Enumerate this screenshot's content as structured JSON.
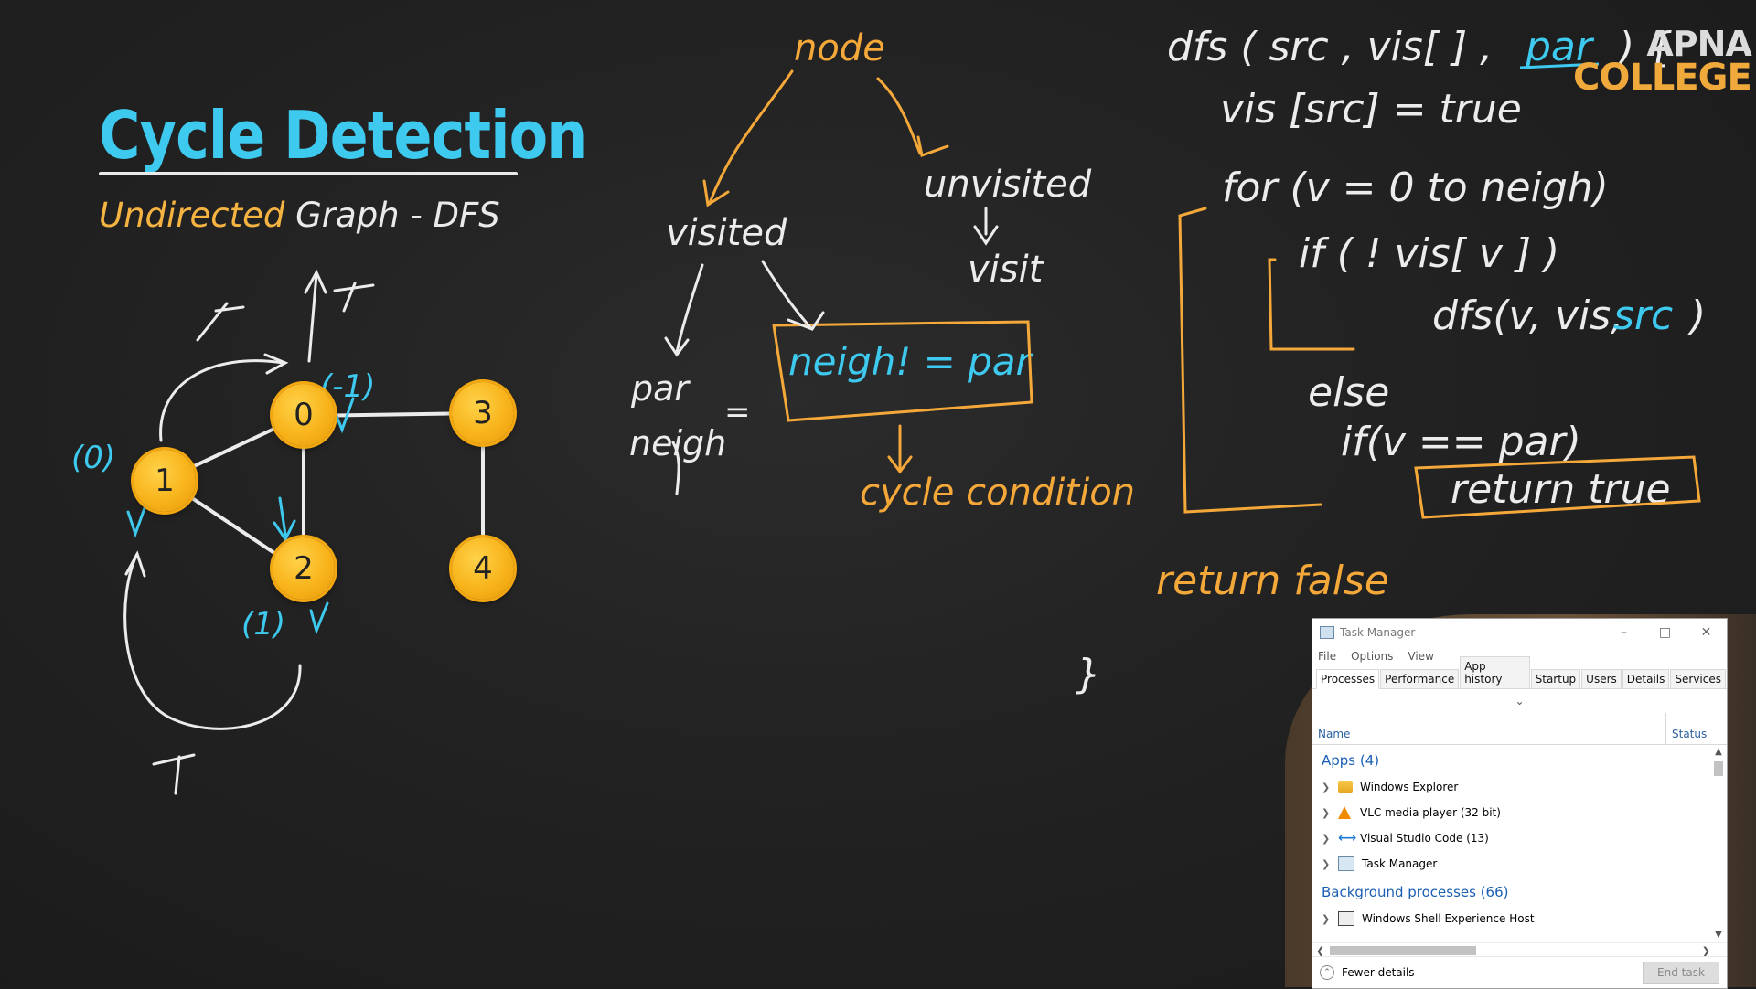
{
  "slide": {
    "title": "Cycle Detection",
    "subtitle_highlight": "Undirected",
    "subtitle_rest": " Graph - DFS"
  },
  "graph": {
    "nodes": [
      "0",
      "1",
      "2",
      "3",
      "4"
    ],
    "annotations": {
      "node0_parent": "(-1)",
      "node1_parent": "(0)",
      "node2_parent": "(1)",
      "visited_mark": "v",
      "tree_mark": "T"
    }
  },
  "notes": {
    "node": "node",
    "visited": "visited",
    "unvisited": "unvisited",
    "visit": "visit",
    "par_neigh": "par",
    "neigh_label": "neigh",
    "equals": "=",
    "condition": "neigh! = par",
    "cycle_condition": "cycle condition"
  },
  "code": {
    "line1": "dfs ( src , vis[ ] ,",
    "line1_par": "par",
    "line1_end": ") {",
    "line2": "vis [src] = true",
    "line3": "for (v = 0 to neigh)",
    "line4": "if ( ! vis[ v ] )",
    "line5": "dfs(v, vis,",
    "line5_src": "src",
    "line5_end": ")",
    "line6": "else",
    "line7": "if(v == par)",
    "line8": "return true",
    "line9": "return false",
    "line10": "}"
  },
  "logo": {
    "line1": "APNA",
    "line2": "COLLEGE"
  },
  "taskmanager": {
    "title": "Task Manager",
    "menu": [
      "File",
      "Options",
      "View"
    ],
    "tabs": [
      "Processes",
      "Performance",
      "App history",
      "Startup",
      "Users",
      "Details",
      "Services"
    ],
    "active_tab": "Processes",
    "columns": {
      "name": "Name",
      "status": "Status"
    },
    "apps_group": "Apps (4)",
    "apps": [
      "Windows Explorer",
      "VLC media player (32 bit)",
      "Visual Studio Code (13)",
      "Task Manager"
    ],
    "background_group": "Background processes (66)",
    "background": [
      "Windows Shell Experience Host"
    ],
    "fewer_details": "Fewer details",
    "end_task": "End task"
  },
  "colors": {
    "cyan": "#3ec9ef",
    "orange": "#f5a83a",
    "chalk": "#ececec",
    "node": "#f8b31a"
  }
}
